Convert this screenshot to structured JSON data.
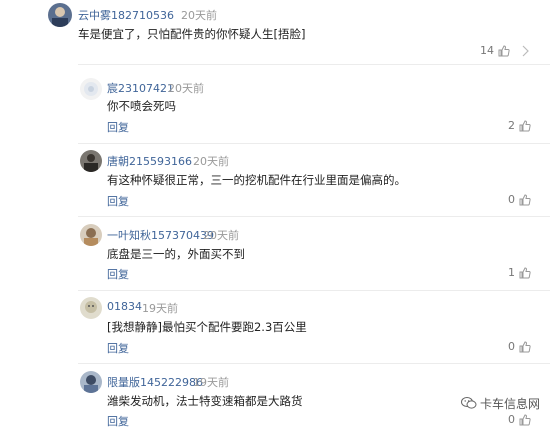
{
  "main_comment": {
    "user": "云中雾182710536",
    "time": "20天前",
    "text": "车是便宜了，只怕配件贵的你怀疑人生[捂脸]",
    "likes": "14"
  },
  "replies": [
    {
      "user": "宸23107421",
      "time": "20天前",
      "text": "你不喷会死吗",
      "reply_label": "回复",
      "likes": "2"
    },
    {
      "user": "唐朝215593166",
      "time": "20天前",
      "text": "有这种怀疑很正常，三一的挖机配件在行业里面是偏高的。",
      "reply_label": "回复",
      "likes": "0"
    },
    {
      "user": "一叶知秋157370439",
      "time": "20天前",
      "text": "底盘是三一的，外面买不到",
      "reply_label": "回复",
      "likes": "1"
    },
    {
      "user": "01834",
      "time": "19天前",
      "text": "[我想静静]最怕买个配件要跑2.3百公里",
      "reply_label": "回复",
      "likes": "0"
    },
    {
      "user": "限量版145222986",
      "time": "19天前",
      "text": "潍柴发动机，法士特变速箱都是大路货",
      "reply_label": "回复",
      "likes": "0"
    }
  ],
  "watermark": "卡车信息网",
  "icons": {
    "like": "thumbs-up-icon",
    "watermark": "wechat-icon"
  },
  "colors": {
    "name": "#406599",
    "time": "#999999",
    "text": "#222222",
    "divider": "#ececec"
  }
}
